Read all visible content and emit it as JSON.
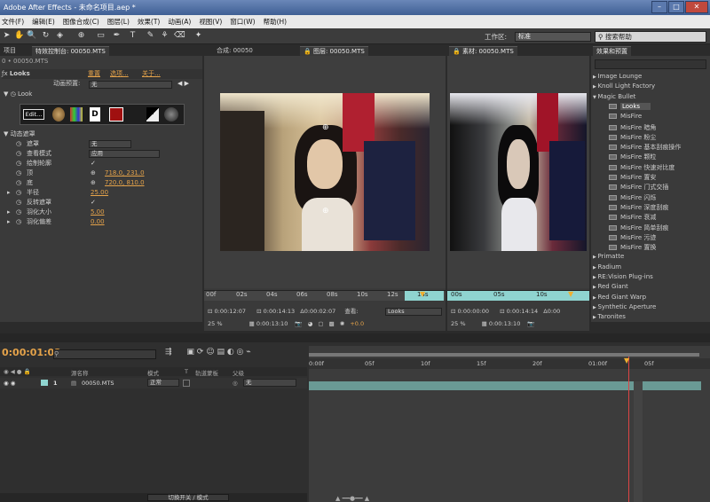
{
  "window": {
    "title": "Adobe After Effects - 未命名项目.aep *",
    "buttons": [
      "–",
      "□",
      "✕"
    ]
  },
  "menu": [
    "文件(F)",
    "编辑(E)",
    "图像合成(C)",
    "图层(L)",
    "效果(T)",
    "动画(A)",
    "视图(V)",
    "窗口(W)",
    "帮助(H)"
  ],
  "toolbar": {
    "workspace_label": "工作区:",
    "workspace_value": "标准",
    "search_placeholder": "搜索帮助"
  },
  "effects_panel": {
    "tab_project": "项目",
    "tab_effects": "特效控制台: 00050.MTS",
    "breadcrumb": "0 • 00050.MTS",
    "effect_name": "Looks",
    "reset": "重置",
    "options": "选项...",
    "about": "关于...",
    "preset_label": "动画预置:",
    "preset_value": "无",
    "look_group": "Look",
    "edit_button": "Edit...",
    "dynamic_mask": "动态遮罩",
    "params": [
      {
        "label": "遮罩",
        "value": "无",
        "kind": "dropdown"
      },
      {
        "label": "查看模式",
        "value": "应用",
        "kind": "dropdown"
      },
      {
        "label": "绘制轮廓",
        "value": "✓",
        "kind": "check"
      },
      {
        "label": "顶",
        "value": "718.0, 231.0",
        "kind": "point"
      },
      {
        "label": "底",
        "value": "720.0, 810.0",
        "kind": "point"
      },
      {
        "label": "半径",
        "value": "25.00",
        "kind": "number"
      },
      {
        "label": "反转遮罩",
        "value": "✓",
        "kind": "check"
      },
      {
        "label": "羽化大小",
        "value": "5.00",
        "kind": "number"
      },
      {
        "label": "羽化偏差",
        "value": "0.00",
        "kind": "number"
      }
    ]
  },
  "viewer_layer": {
    "tab_comp": "合成: 00050",
    "tab_layer": "图层: 00050.MTS",
    "ruler": [
      "00f",
      "02s",
      "04s",
      "06s",
      "08s",
      "10s",
      "12s",
      "14s"
    ],
    "time_current": "0:00:12:07",
    "time_in": "0:00:14:13",
    "time_dur": "0:00:02:07",
    "view_label": "查看:",
    "view_value": "Looks",
    "zoom": "25 %",
    "timecode": "0:00:13:10",
    "exposure": "+0.0"
  },
  "viewer_footage": {
    "tab": "素材: 00050.MTS",
    "ruler": [
      "00s",
      "05s",
      "10s"
    ],
    "time_current": "0:00:00:00",
    "time_in": "0:00:14:14",
    "time_dur": "0:00",
    "zoom": "25 %",
    "timecode": "0:00:13:10"
  },
  "presets_panel": {
    "tab": "效果和预置",
    "items": [
      {
        "label": "Image Lounge",
        "level": 0,
        "open": false
      },
      {
        "label": "Knoll Light Factory",
        "level": 0,
        "open": false
      },
      {
        "label": "Magic Bullet",
        "level": 0,
        "open": true
      },
      {
        "label": "Looks",
        "level": 1,
        "selected": true
      },
      {
        "label": "MisFire",
        "level": 1
      },
      {
        "label": "MisFire 暗角",
        "level": 1
      },
      {
        "label": "MisFire 粉尘",
        "level": 1
      },
      {
        "label": "MisFire 基本刮痕操作",
        "level": 1
      },
      {
        "label": "MisFire 颗粒",
        "level": 1
      },
      {
        "label": "MisFire 快速对比度",
        "level": 1
      },
      {
        "label": "MisFire 置安",
        "level": 1
      },
      {
        "label": "MisFire 门式交插",
        "level": 1
      },
      {
        "label": "MisFire 闪烁",
        "level": 1
      },
      {
        "label": "MisFire 深度刮痕",
        "level": 1
      },
      {
        "label": "MisFire 衰减",
        "level": 1
      },
      {
        "label": "MisFire 简单刮痕",
        "level": 1
      },
      {
        "label": "MisFire 污迹",
        "level": 1
      },
      {
        "label": "MisFire 置换",
        "level": 1
      },
      {
        "label": "Primatte",
        "level": 0,
        "open": false
      },
      {
        "label": "Radium",
        "level": 0,
        "open": false
      },
      {
        "label": "RE:Vision Plug-ins",
        "level": 0,
        "open": false
      },
      {
        "label": "Red Giant",
        "level": 0,
        "open": false
      },
      {
        "label": "Red Giant Warp",
        "level": 0,
        "open": false
      },
      {
        "label": "Synthetic Aperture",
        "level": 0,
        "open": false
      },
      {
        "label": "Taronites",
        "level": 0,
        "open": false
      }
    ]
  },
  "timeline": {
    "current_time": "0:00:01:03",
    "columns": [
      "源名称",
      "模式",
      "T",
      "轨道蒙板",
      "父级"
    ],
    "ruler": [
      "0:00f",
      "05f",
      "10f",
      "15f",
      "20f",
      "01:00f",
      "05f"
    ],
    "layer": {
      "index": "1",
      "name": "00050.MTS",
      "mode": "正常",
      "parent": "无"
    },
    "footer_toggle": "切换开关 / 模式"
  }
}
